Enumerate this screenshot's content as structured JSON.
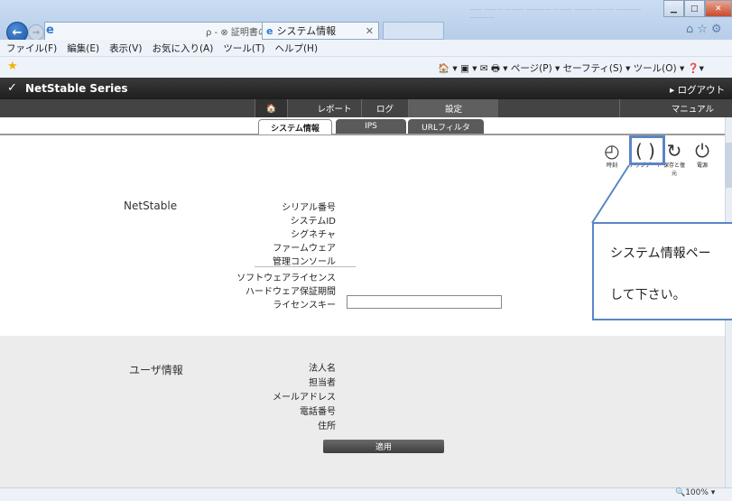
{
  "browser": {
    "tab_title": "ρ - ⊗ 証明書の… ⊠ C ✕",
    "active_tab_title": "システム情報",
    "faint_text": "—— ——— ———\n———— ——— ———\n——— ———— ————",
    "right_icons": "⌂☆⚙",
    "window_buttons": {
      "min": "▁",
      "max": "□",
      "close": "✕"
    },
    "menu": [
      "ファイル(F)",
      "編集(E)",
      "表示(V)",
      "お気に入り(A)",
      "ツール(T)",
      "ヘルプ(H)"
    ],
    "command_bar": "🏠 ▾  ▣ ▾  ✉  🖶 ▾  ページ(P) ▾  セーフティ(S) ▾  ツール(O) ▾  ❓▾",
    "zoom": "🔍100%  ▾"
  },
  "app": {
    "brand": "NetStable Series",
    "logout": "▸ ログアウト",
    "nav": {
      "home": "🏠",
      "report": "レポート",
      "log": "ログ",
      "settings": "設定",
      "manual": "マニュアル"
    },
    "subtabs": {
      "system": "システム情報",
      "ips": "IPS",
      "url": "URLフィルタ"
    },
    "icons": {
      "clock_label": "時刻",
      "update_label": "アップデート",
      "save_label": "保存と復元",
      "power_label": "電源"
    },
    "netstable": {
      "title": "NetStable",
      "fields": [
        "シリアル番号",
        "システムID",
        "シグネチャ",
        "ファームウェア",
        "管理コンソール"
      ],
      "license_fields": [
        "ソフトウェアライセンス",
        "ハードウェア保証期間",
        "ライセンスキー"
      ]
    },
    "user": {
      "title": "ユーザ情報",
      "fields": [
        "法人名",
        "担当者",
        "メールアドレス",
        "電話番号",
        "住所"
      ]
    },
    "apply_label": "適用"
  },
  "callout": {
    "line1": "システム情報ペー",
    "line2": "して下さい。"
  }
}
